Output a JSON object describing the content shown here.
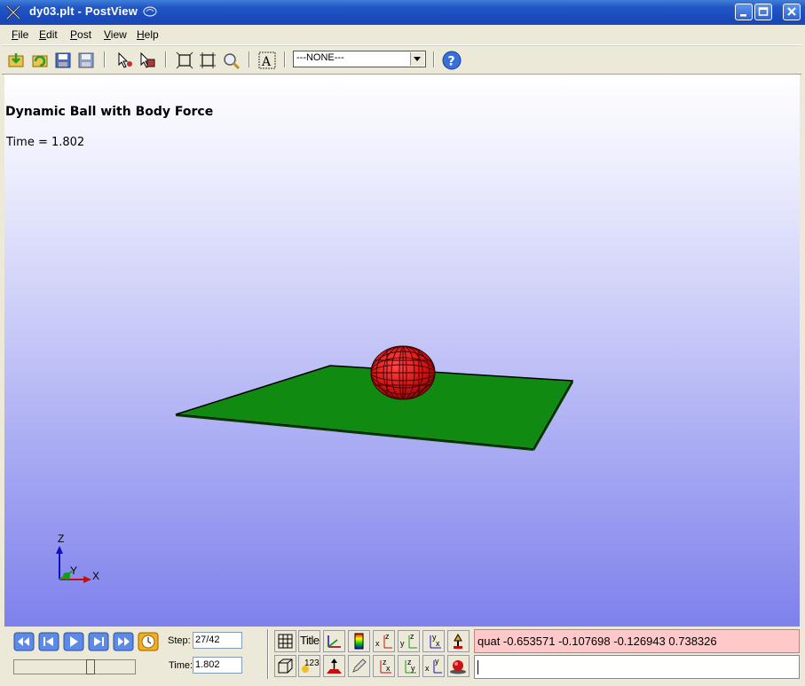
{
  "window": {
    "title": "dy03.plt - PostView"
  },
  "menu": {
    "file": "File",
    "edit": "Edit",
    "post": "Post",
    "view": "View",
    "help": "Help"
  },
  "toolbar": {
    "selection_combo": "---NONE---"
  },
  "viewport": {
    "plot_title": "Dynamic Ball with Body Force",
    "time_label": "Time = 1.802",
    "axis_triad": {
      "z": "Z",
      "y": "Y",
      "x": "X"
    },
    "colors": {
      "plate": "#108a10",
      "ball": "#e01818",
      "mesh": "#200000"
    }
  },
  "animation": {
    "step_label": "Step:",
    "step_value": "27/42",
    "time_field_label": "Time:",
    "time_value": "1.802",
    "slider_position": 0.64
  },
  "view_buttons": {
    "title_label": "Title",
    "numbers_label": "123"
  },
  "command": {
    "output": "quat -0.653571 -0.107698 -0.126943 0.738326",
    "input": ""
  }
}
